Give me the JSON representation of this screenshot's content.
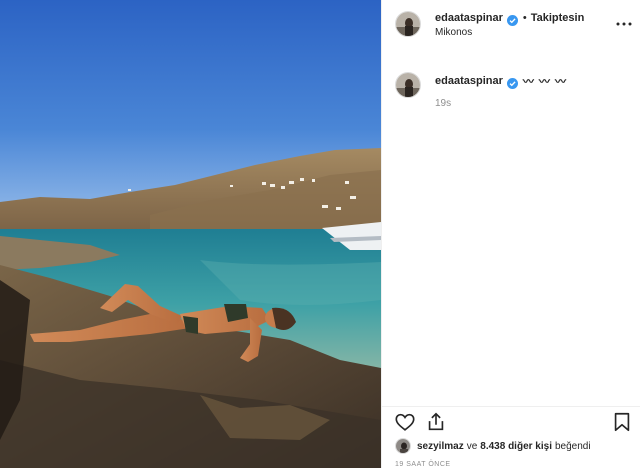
{
  "post": {
    "author": "edaataspinar",
    "follow_status": "Takiptesin",
    "separator": "•",
    "location": "Mikonos",
    "caption": "〰 〰 〰",
    "caption_age": "19s",
    "likes": {
      "first_liker": "sezyilmaz",
      "connector": "ve",
      "others": "8.438 diğer kişi",
      "suffix": "beğendi"
    },
    "timestamp": "19 SAAT ÖNCE"
  },
  "icons": {
    "verified": "verified-badge-icon",
    "more": "more-options-icon",
    "like": "heart-icon",
    "share": "share-icon",
    "save": "bookmark-icon"
  },
  "colors": {
    "verified_blue": "#3897f0",
    "text_primary": "#262626",
    "text_secondary": "#8e8e8e",
    "border": "#efefef"
  }
}
